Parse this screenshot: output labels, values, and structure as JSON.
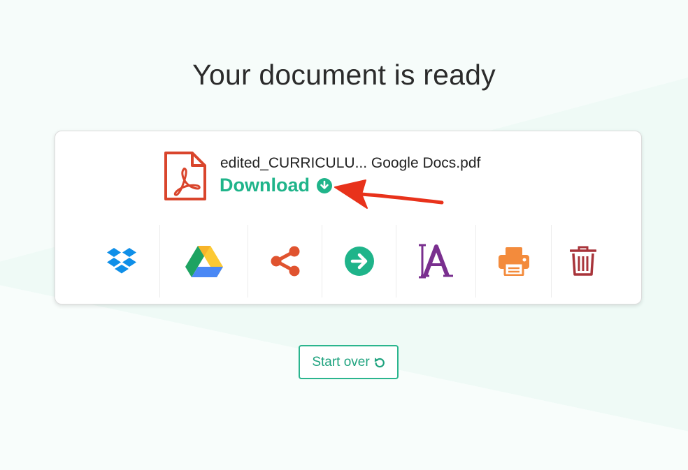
{
  "page": {
    "title": "Your document is ready"
  },
  "file": {
    "name": "edited_CURRICULU... Google Docs.pdf",
    "icon": "pdf-file-icon"
  },
  "download": {
    "label": "Download",
    "icon": "download-circle-icon"
  },
  "actions": [
    {
      "id": "dropbox",
      "icon": "dropbox-icon",
      "color": "#0f8fe8"
    },
    {
      "id": "google-drive",
      "icon": "google-drive-icon",
      "color": "#1ea362"
    },
    {
      "id": "share",
      "icon": "share-icon",
      "color": "#e0532f"
    },
    {
      "id": "continue",
      "icon": "arrow-right-circle-icon",
      "color": "#1fb48a"
    },
    {
      "id": "ocr",
      "icon": "text-recognition-icon",
      "color": "#7a2f8f"
    },
    {
      "id": "print",
      "icon": "printer-icon",
      "color": "#f38b3c"
    },
    {
      "id": "delete",
      "icon": "trash-icon",
      "color": "#a8343a"
    }
  ],
  "start_over": {
    "label": "Start over",
    "icon": "reset-icon"
  },
  "colors": {
    "accent": "#1fb48a",
    "pdf": "#d9452c",
    "annotation_arrow": "#e8321b"
  }
}
